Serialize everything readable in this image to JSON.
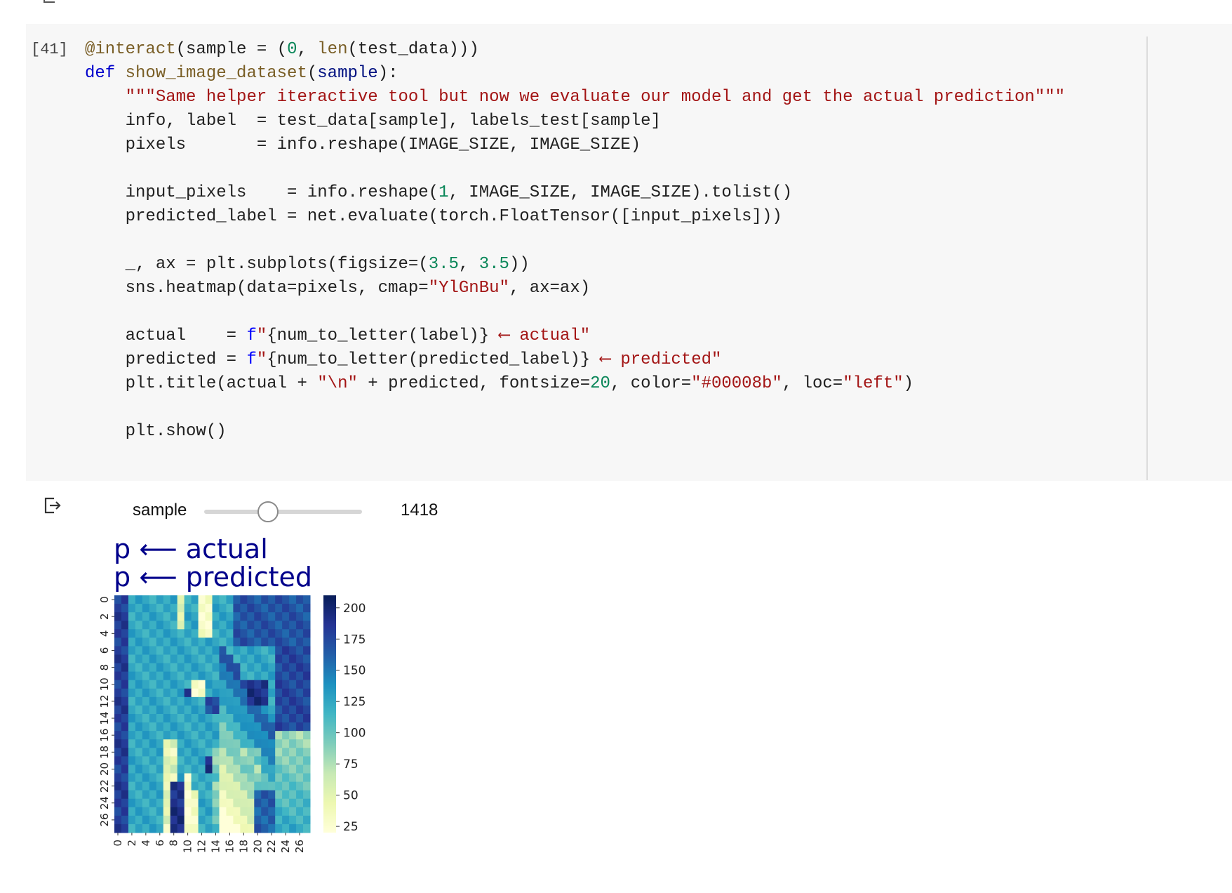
{
  "cell": {
    "exec_count": "[41]",
    "code_lines": [
      [
        {
          "t": "@interact",
          "c": "dec"
        },
        {
          "t": "(sample = (",
          "c": ""
        },
        {
          "t": "0",
          "c": "num"
        },
        {
          "t": ", ",
          "c": ""
        },
        {
          "t": "len",
          "c": "fn"
        },
        {
          "t": "(test_data)))",
          "c": ""
        }
      ],
      [
        {
          "t": "def ",
          "c": "kw"
        },
        {
          "t": "show_image_dataset",
          "c": "fn"
        },
        {
          "t": "(",
          "c": ""
        },
        {
          "t": "sample",
          "c": "var"
        },
        {
          "t": "):",
          "c": ""
        }
      ],
      [
        {
          "t": "    ",
          "c": ""
        },
        {
          "t": "\"\"\"Same helper iteractive tool but now we evaluate our model and get the actual prediction\"\"\"",
          "c": "str"
        }
      ],
      [
        {
          "t": "    info, label  = test_data[sample], labels_test[sample]",
          "c": ""
        }
      ],
      [
        {
          "t": "    pixels       = info.reshape(IMAGE_SIZE, IMAGE_SIZE)",
          "c": ""
        }
      ],
      [],
      [
        {
          "t": "    input_pixels    = info.reshape(",
          "c": ""
        },
        {
          "t": "1",
          "c": "num"
        },
        {
          "t": ", IMAGE_SIZE, IMAGE_SIZE).tolist()",
          "c": ""
        }
      ],
      [
        {
          "t": "    predicted_label = net.evaluate(torch.FloatTensor([input_pixels]))",
          "c": ""
        }
      ],
      [],
      [
        {
          "t": "    _, ax = plt.subplots(figsize=(",
          "c": ""
        },
        {
          "t": "3.5",
          "c": "num"
        },
        {
          "t": ", ",
          "c": ""
        },
        {
          "t": "3.5",
          "c": "num"
        },
        {
          "t": "))",
          "c": ""
        }
      ],
      [
        {
          "t": "    sns.heatmap(data=pixels, cmap=",
          "c": ""
        },
        {
          "t": "\"YlGnBu\"",
          "c": "str"
        },
        {
          "t": ", ax=ax)",
          "c": ""
        }
      ],
      [],
      [
        {
          "t": "    actual    = ",
          "c": ""
        },
        {
          "t": "f",
          "c": "fst"
        },
        {
          "t": "\"",
          "c": "str"
        },
        {
          "t": "{num_to_letter(label)}",
          "c": ""
        },
        {
          "t": " ⟵ actual\"",
          "c": "str"
        }
      ],
      [
        {
          "t": "    predicted = ",
          "c": ""
        },
        {
          "t": "f",
          "c": "fst"
        },
        {
          "t": "\"",
          "c": "str"
        },
        {
          "t": "{num_to_letter(predicted_label)}",
          "c": ""
        },
        {
          "t": " ⟵ predicted\"",
          "c": "str"
        }
      ],
      [
        {
          "t": "    plt.title(actual + ",
          "c": ""
        },
        {
          "t": "\"\\n\"",
          "c": "str"
        },
        {
          "t": " + predicted, fontsize=",
          "c": ""
        },
        {
          "t": "20",
          "c": "num"
        },
        {
          "t": ", color=",
          "c": ""
        },
        {
          "t": "\"#00008b\"",
          "c": "str"
        },
        {
          "t": ", loc=",
          "c": ""
        },
        {
          "t": "\"left\"",
          "c": "str"
        },
        {
          "t": ")",
          "c": ""
        }
      ],
      [],
      [
        {
          "t": "    plt.show()",
          "c": ""
        }
      ]
    ]
  },
  "output": {
    "slider_label": "sample",
    "slider_value": "1418",
    "slider_fraction": 0.36,
    "plot_title": "p ⟵ actual\np ⟵ predicted",
    "title_color": "#00008b"
  },
  "chart_data": {
    "type": "heatmap",
    "cmap": "YlGnBu",
    "title": "p ⟵ actual\np ⟵ predicted",
    "x_ticks": [
      "0",
      "2",
      "4",
      "6",
      "8",
      "10",
      "12",
      "14",
      "16",
      "18",
      "20",
      "22",
      "24",
      "26"
    ],
    "y_ticks": [
      "0",
      "2",
      "4",
      "6",
      "8",
      "10",
      "12",
      "14",
      "16",
      "18",
      "20",
      "22",
      "24",
      "26"
    ],
    "colorbar_ticks": [
      200,
      175,
      150,
      125,
      100,
      75,
      50,
      25
    ],
    "colorbar_range": [
      20,
      210
    ],
    "size": [
      28,
      28
    ]
  }
}
